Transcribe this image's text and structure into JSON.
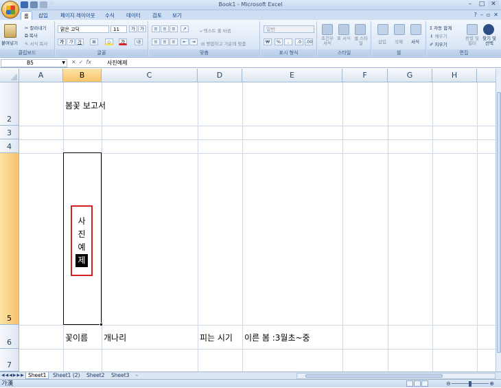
{
  "window": {
    "title": "Book1 - Microsoft Excel"
  },
  "ribbon_tabs": [
    "홈",
    "삽입",
    "페이지 레이아웃",
    "수식",
    "데이터",
    "검토",
    "보기"
  ],
  "clipboard": {
    "paste": "붙여넣기",
    "cut": "잘라내기",
    "copy": "복사",
    "format_painter": "서식 복사",
    "label": "클립보드"
  },
  "font": {
    "name": "맑은 고딕",
    "size": "11",
    "label": "글꼴",
    "bold": "가",
    "italic": "가",
    "underline": "가"
  },
  "alignment": {
    "wrap_text": "텍스트 줄 바꿈",
    "merge_center": "병합하고 가운데 맞춤",
    "label": "맞춤"
  },
  "number": {
    "format": "일반",
    "label": "표시 형식"
  },
  "styles": {
    "conditional": "조건부 서식",
    "table": "표 서식",
    "cell": "셀 스타일",
    "label": "스타일"
  },
  "cells": {
    "insert": "삽입",
    "delete": "삭제",
    "format": "서식",
    "label": "셀"
  },
  "editing": {
    "autosum": "자동 합계",
    "fill": "채우기",
    "clear": "지우기",
    "sort_filter": "정렬 및 필터",
    "find_select": "찾기 및 선택",
    "label": "편집"
  },
  "formula_bar": {
    "name_box": "B5",
    "fx": "fx",
    "content": "사진예제"
  },
  "columns": [
    "A",
    "B",
    "C",
    "D",
    "E",
    "F",
    "G",
    "H"
  ],
  "rows": [
    "2",
    "3",
    "4",
    "5",
    "6",
    "7"
  ],
  "cells_data": {
    "b2": "봄꽃 보고서",
    "b6": "꽃이름",
    "c6": "개나리",
    "d6": "피는 시기",
    "e6": "이른 봄 :3월초~중"
  },
  "textbox": {
    "chars": [
      "사",
      "진",
      "예",
      "제"
    ]
  },
  "sheets": [
    "Sheet1",
    "Sheet1 (2)",
    "Sheet2",
    "Sheet3"
  ],
  "status": {
    "mode": "가漢"
  },
  "colors": {
    "selection_header": "#f6c36b",
    "textbox_border": "#d02020",
    "ribbon_blue": "#15428b"
  }
}
